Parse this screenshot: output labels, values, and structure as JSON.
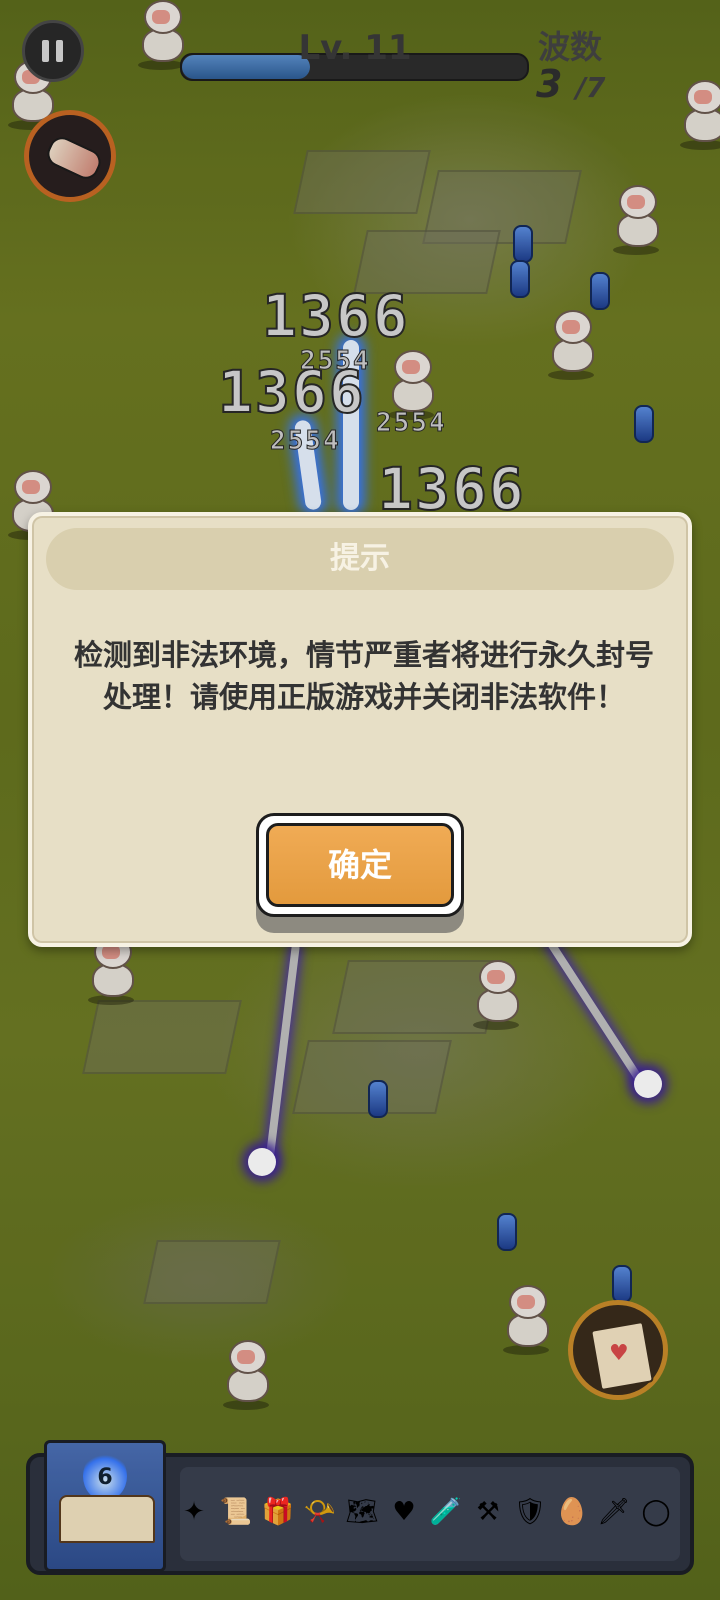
{
  "hud": {
    "level_label": "Lv. 11",
    "level_progress": 0.37,
    "wave_title": "波数",
    "wave_current": "3",
    "wave_total": "/7"
  },
  "damage_numbers": [
    "1366",
    "1366",
    "1366",
    "2554",
    "2554",
    "2554"
  ],
  "dialog": {
    "title": "提示",
    "message": "检测到非法环境，情节严重者将进行永久封号处理！请使用正版游戏并关闭非法软件！",
    "confirm_label": "确定"
  },
  "bottom_bar": {
    "book_level": "6",
    "items": [
      {
        "icon": "shuriken-icon",
        "glyph": "✦"
      },
      {
        "icon": "scroll-icon",
        "glyph": "📜"
      },
      {
        "icon": "gift-box-icon",
        "glyph": "🎁"
      },
      {
        "icon": "horn-icon",
        "glyph": "📯"
      },
      {
        "icon": "map-icon",
        "glyph": "🗺"
      },
      {
        "icon": "heart-card-icon",
        "glyph": "♥"
      },
      {
        "icon": "potion-icon",
        "glyph": "🧪"
      },
      {
        "icon": "mace-icon",
        "glyph": "⚒"
      },
      {
        "icon": "shield-icon",
        "glyph": "🛡"
      },
      {
        "icon": "egg-icon",
        "glyph": "🥚"
      },
      {
        "icon": "sword-icon",
        "glyph": "🗡"
      },
      {
        "icon": "ring-icon",
        "glyph": "◯"
      }
    ]
  },
  "colors": {
    "dialog_bg": "#e7dfc6",
    "confirm_button": "#eba24a",
    "level_fill": "#3e73b3"
  }
}
